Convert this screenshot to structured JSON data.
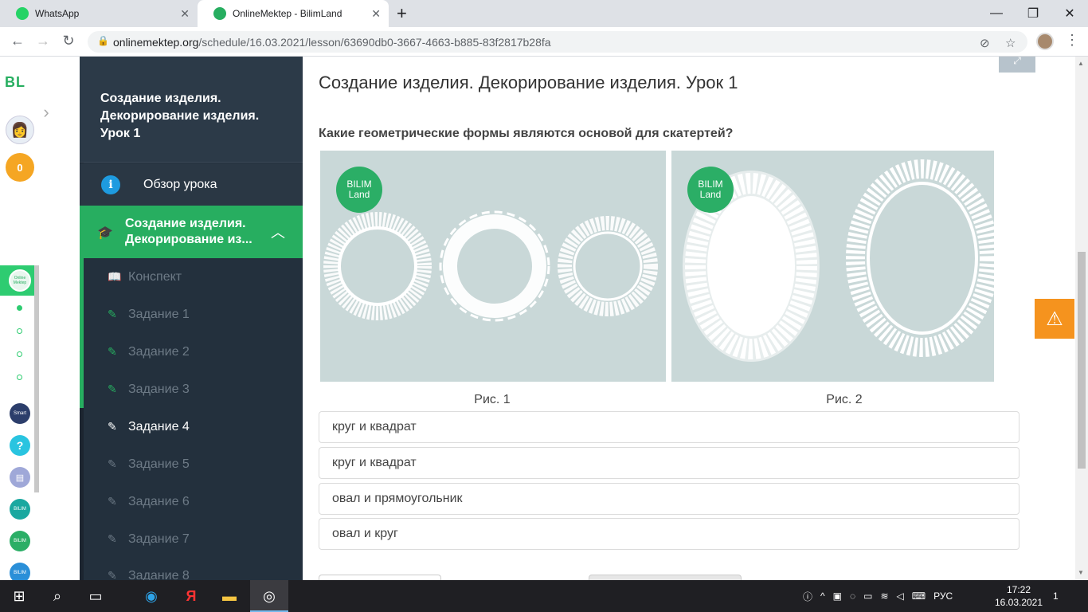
{
  "browser": {
    "tabs": [
      {
        "title": "WhatsApp",
        "active": false,
        "icon": "whatsapp-icon"
      },
      {
        "title": "OnlineMektep - BilimLand",
        "active": true,
        "icon": "bilimland-icon"
      }
    ],
    "url_domain": "onlinemektep.org",
    "url_path": "/schedule/16.03.2021/lesson/63690db0-3667-4663-b885-83f2817b28fa"
  },
  "rail": {
    "logo": "BL",
    "coins": "0",
    "online_mektep": "Online Mektep"
  },
  "sidebar": {
    "lesson_title": "Создание изделия. Декорирование изделия. Урок 1",
    "overview_label": "Обзор урока",
    "current_section": "Создание изделия. Декорирование из...",
    "items": [
      {
        "label": "Конспект"
      },
      {
        "label": "Задание 1"
      },
      {
        "label": "Задание 2"
      },
      {
        "label": "Задание 3"
      },
      {
        "label": "Задание 4"
      },
      {
        "label": "Задание 5"
      },
      {
        "label": "Задание 6"
      },
      {
        "label": "Задание 7"
      },
      {
        "label": "Задание 8"
      }
    ]
  },
  "main": {
    "title": "Создание изделия. Декорирование изделия. Урок 1",
    "question": "Какие геометрические формы являются основой для скатертей?",
    "figure_badge": "BILIM Land",
    "captions": [
      "Рис. 1",
      "Рис. 2"
    ],
    "answers": [
      "круг и квадрат",
      "круг и квадрат",
      "овал и прямоугольник",
      "овал и круг"
    ]
  },
  "taskbar": {
    "language": "РУС",
    "time": "17:22",
    "date": "16.03.2021",
    "notifications": "1"
  },
  "colors": {
    "accent_green": "#27ae60",
    "sidebar_bg": "#23303d",
    "warning_orange": "#f5931e"
  }
}
